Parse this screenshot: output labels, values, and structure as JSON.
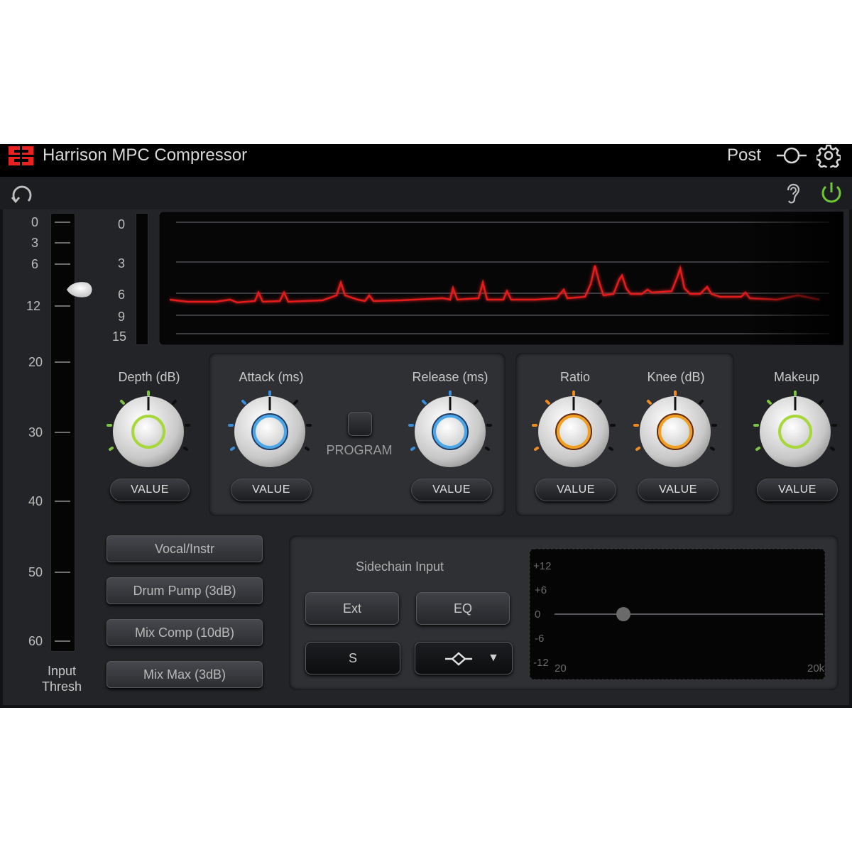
{
  "app": {
    "title": "Harrison MPC Compressor",
    "mode": "Post"
  },
  "colors": {
    "accent_red": "#e8231f",
    "power_green": "#6fc832",
    "meter_red": "#e31a1a"
  },
  "icons": {
    "logo": "harrison-logo-icon",
    "routing": "sidechain-routing-icon",
    "settings": "gear-icon",
    "reset": "reset-icon",
    "listen": "ear-icon",
    "power": "power-icon"
  },
  "input_scale": {
    "labels": [
      "0",
      "3",
      "6",
      "12",
      "20",
      "30",
      "40",
      "50",
      "60"
    ],
    "caption_line1": "Input",
    "caption_line2": "Thresh",
    "thresh_value": 10
  },
  "meter": {
    "gr_labels": [
      "0",
      "3",
      "6",
      "9",
      "15"
    ]
  },
  "knobs": {
    "depth": {
      "label": "Depth (dB)",
      "value": "VALUE"
    },
    "attack": {
      "label": "Attack (ms)",
      "value": "VALUE"
    },
    "program": {
      "label": "PROGRAM"
    },
    "release": {
      "label": "Release (ms)",
      "value": "VALUE"
    },
    "ratio": {
      "label": "Ratio",
      "value": "VALUE"
    },
    "knee": {
      "label": "Knee (dB)",
      "value": "VALUE"
    },
    "makeup": {
      "label": "Makeup",
      "value": "VALUE"
    }
  },
  "presets": [
    "Vocal/Instr",
    "Drum Pump (3dB)",
    "Mix Comp (10dB)",
    "Mix Max (3dB)"
  ],
  "sidechain": {
    "title": "Sidechain Input",
    "ext_label": "Ext",
    "eq_label": "EQ",
    "s_label": "S",
    "filter_dropdown_arrow": "▼",
    "eq_graph": {
      "y_labels": [
        "+12",
        "+6",
        "0",
        "-6",
        "-12"
      ],
      "x_start": "20",
      "x_end": "20k"
    }
  }
}
